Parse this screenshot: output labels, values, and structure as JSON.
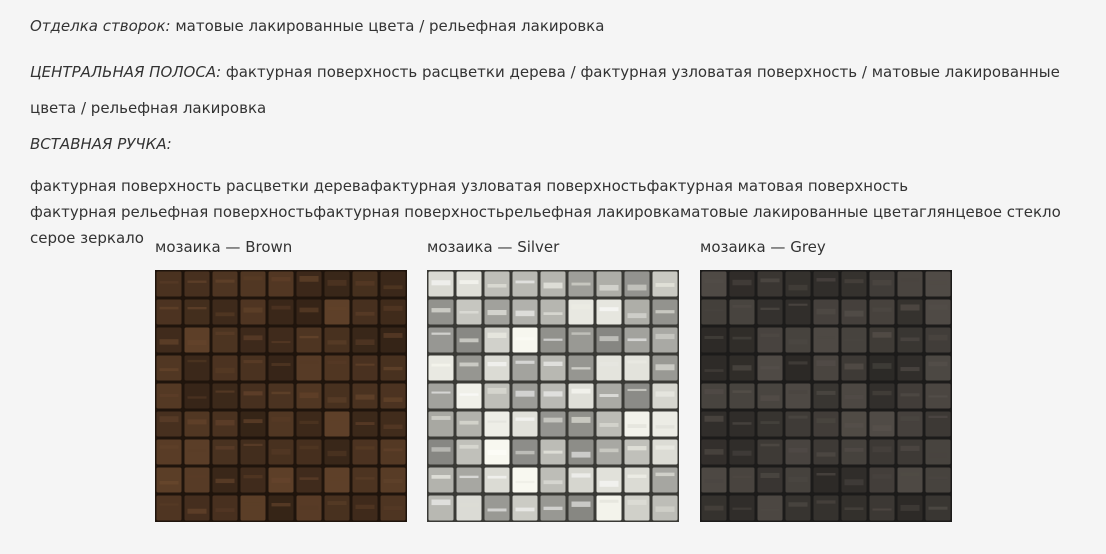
{
  "lines": {
    "sash_label": "Отделка створок:",
    "sash_value": " матовые лакированные цвета / рельефная лакировка",
    "center_label": "ЦЕНТРАЛЬНАЯ ПОЛОСА:",
    "center_value_1": " фактурная поверхность расцветки дерева / фактурная узловатая поверхность / матовые лакированные",
    "center_value_2": "цвета / рельефная лакировка",
    "handle_label": "ВСТАВНАЯ РУЧКА:",
    "handle_line_1": "фактурная поверхность расцветки деревафактурная узловатая поверхностьфактурная матовая поверхность",
    "handle_line_2": "фактурная рельефная поверхностьфактурная поверхностьрельефная лакировкаматовые лакированные цветаглянцевое стекло",
    "handle_line_3": "серое зеркало"
  },
  "swatches": [
    {
      "caption": "мозаика — Brown",
      "grout": "#1f140c",
      "tile": "#4a3220",
      "icon": "brown-mosaic-image"
    },
    {
      "caption": "мозаика — Silver",
      "grout": "#3a3a36",
      "tile": "#bfbfb9",
      "icon": "silver-mosaic-image"
    },
    {
      "caption": "мозаика — Grey",
      "grout": "#1c1b1a",
      "tile": "#3e3a36",
      "icon": "grey-mosaic-image"
    }
  ]
}
